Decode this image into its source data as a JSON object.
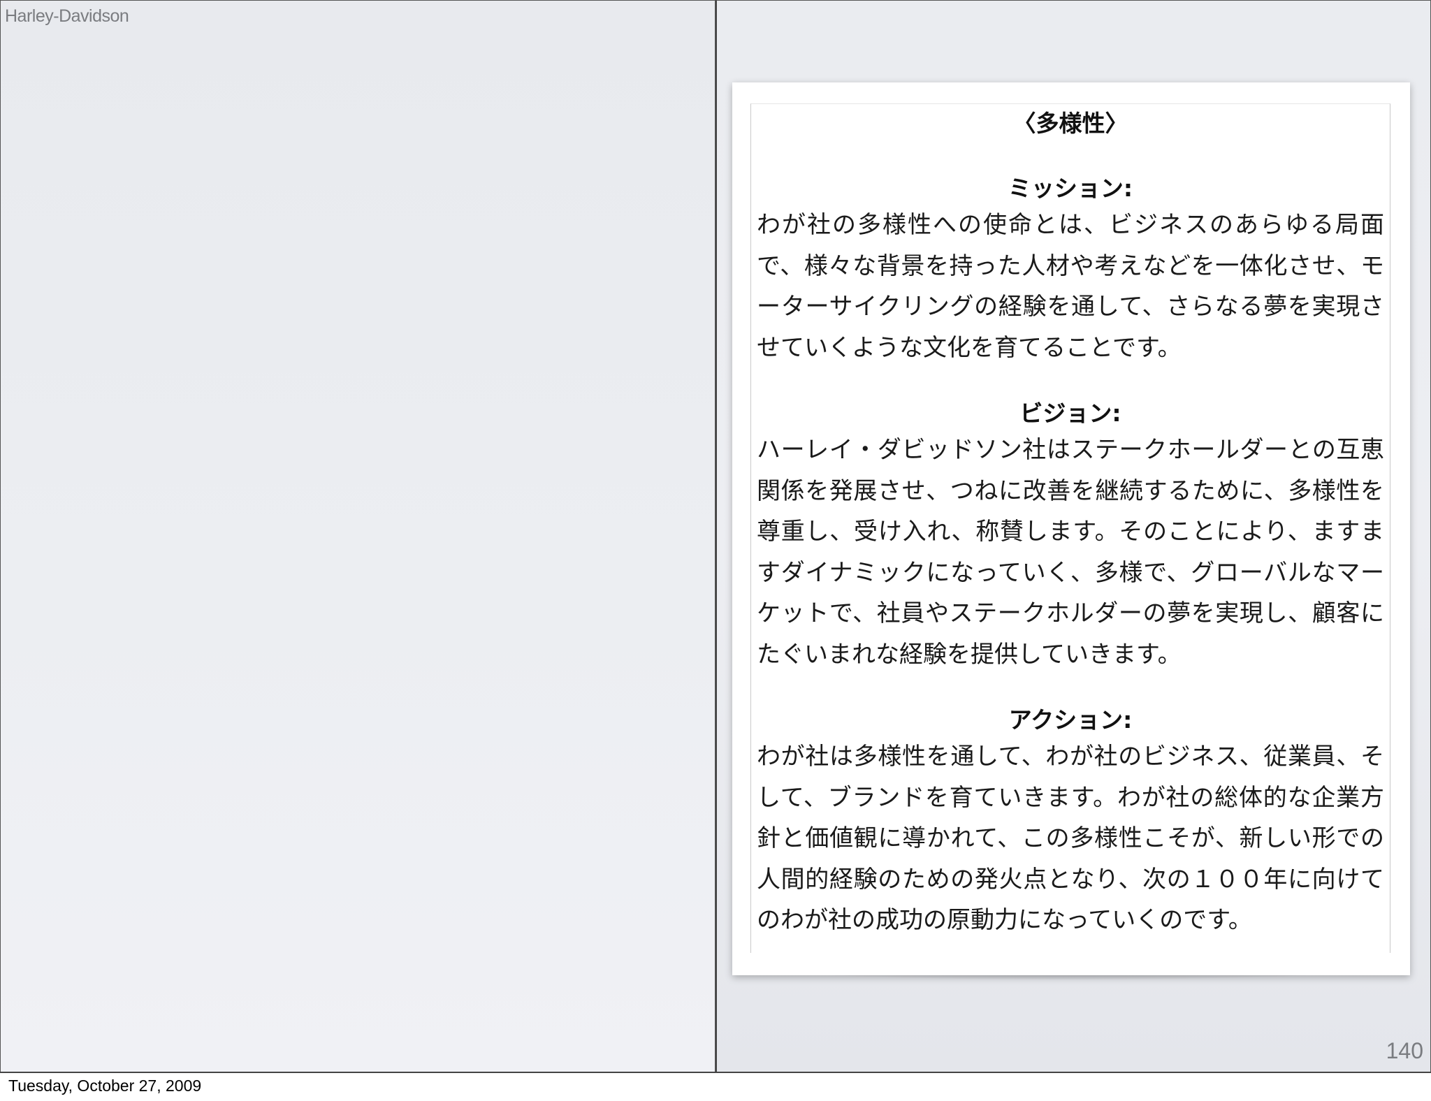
{
  "header": {
    "doc_title": "Harley-Davidson"
  },
  "slide": {
    "page_number": "140"
  },
  "card": {
    "title": "〈多様性〉",
    "sections": [
      {
        "heading": "ミッション:",
        "body": "わが社の多様性への使命とは、ビジネスのあらゆる局面で、様々な背景を持った人材や考えなどを一体化させ、モーターサイクリングの経験を通して、さらなる夢を実現させていくような文化を育てることです。"
      },
      {
        "heading": "ビジョン:",
        "body": "ハーレイ・ダビッドソン社はステークホールダーとの互恵関係を発展させ、つねに改善を継続するために、多様性を尊重し、受け入れ、称賛します。そのことにより、ますますダイナミックになっていく、多様で、グローバルなマーケットで、社員やステークホルダーの夢を実現し、顧客にたぐいまれな経験を提供していきます。"
      },
      {
        "heading": "アクション:",
        "body": "わが社は多様性を通して、わが社のビジネス、従業員、そして、ブランドを育ていきます。わが社の総体的な企業方針と価値観に導かれて、この多様性こそが、新しい形での人間的経験のための発火点となり、次の１００年に向けてのわが社の成功の原動力になっていくのです。"
      }
    ]
  },
  "footer": {
    "date": "Tuesday, October 27, 2009"
  },
  "colors": {
    "background": "#eceef2",
    "card": "#ffffff",
    "text": "#1a1a1a",
    "muted_text": "#7a7c80"
  }
}
